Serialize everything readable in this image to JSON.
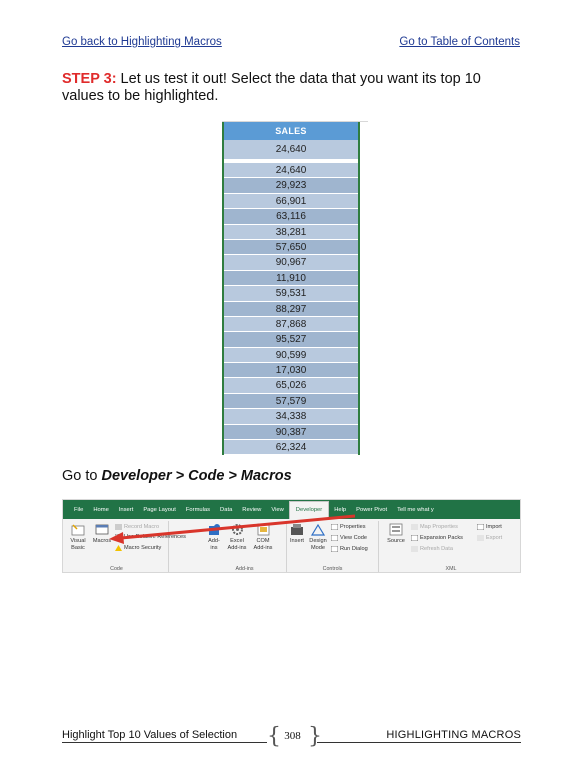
{
  "nav": {
    "back_link": "Go back to Highlighting Macros",
    "toc_link": "Go to Table of Contents"
  },
  "step": {
    "label": "STEP 3:",
    "text": " Let us test it out! Select the data that you want its top 10 values to be highlighted."
  },
  "sheet": {
    "header": "SALES",
    "first_value": "24,640",
    "values": [
      "24,640",
      "29,923",
      "66,901",
      "63,116",
      "38,281",
      "57,650",
      "90,967",
      "11,910",
      "59,531",
      "88,297",
      "87,868",
      "95,527",
      "90,599",
      "17,030",
      "65,026",
      "57,579",
      "34,338",
      "90,387",
      "62,324"
    ]
  },
  "instruction": {
    "prefix": "Go to ",
    "path": "Developer > Code > Macros"
  },
  "ribbon": {
    "tabs": [
      "File",
      "Home",
      "Insert",
      "Page Layout",
      "Formulas",
      "Data",
      "Review",
      "View",
      "Developer",
      "Help",
      "Power Pivot",
      "Tell me what y"
    ],
    "active_tab": "Developer",
    "groups": {
      "code": {
        "name": "Code",
        "visual_basic": "Visual Basic",
        "macros": "Macros",
        "record": "Record Macro",
        "relative": "Use Relative References",
        "security": "Macro Security"
      },
      "addins": {
        "name": "Add-ins",
        "addins": "Add- ins",
        "excel_addins": "Excel Add-ins",
        "com_addins": "COM Add-ins"
      },
      "controls": {
        "name": "Controls",
        "insert": "Insert",
        "design_mode": "Design Mode",
        "properties": "Properties",
        "view_code": "View Code",
        "run_dialog": "Run Dialog"
      },
      "xml": {
        "name": "XML",
        "source": "Source",
        "map_properties": "Map Properties",
        "expansion_packs": "Expansion Packs",
        "refresh_data": "Refresh Data",
        "import": "Import",
        "export": "Export"
      }
    },
    "colors": {
      "excel_green": "#217346",
      "arrow_red": "#d9352b"
    }
  },
  "footer": {
    "left": "Highlight Top 10 Values of Selection",
    "page_number": "308",
    "right": "HIGHLIGHTING MACROS"
  }
}
